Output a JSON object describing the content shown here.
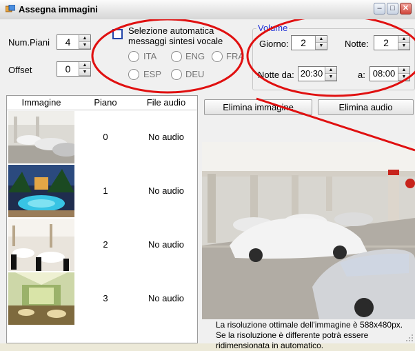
{
  "window": {
    "title": "Assegna immagini",
    "minimize": "–",
    "maximize": "□",
    "close": "✕"
  },
  "settings": {
    "num_piani": {
      "label": "Num.Piani",
      "value": "4"
    },
    "offset": {
      "label": "Offset",
      "value": "0"
    },
    "auto_selection": {
      "label_line1": "Selezione automatica",
      "label_line2": "messaggi sintesi vocale",
      "checked": false,
      "languages": [
        "ITA",
        "ENG",
        "FRA",
        "ESP",
        "DEU"
      ]
    }
  },
  "volume": {
    "legend": "Volume",
    "giorno": {
      "label": "Giorno:",
      "value": "2"
    },
    "notte": {
      "label": "Notte:",
      "value": "2"
    },
    "notte_da": {
      "label": "Notte da:",
      "value": "20:30"
    },
    "a": {
      "label": "a:",
      "value": "08:00"
    }
  },
  "grid": {
    "columns": [
      "Immagine",
      "Piano",
      "File audio"
    ],
    "rows": [
      {
        "thumbnail": "parking-garage-thumbnail",
        "piano": "0",
        "audio": "No audio"
      },
      {
        "thumbnail": "pool-resort-thumbnail",
        "piano": "1",
        "audio": "No audio"
      },
      {
        "thumbnail": "banquet-hall-thumbnail",
        "piano": "2",
        "audio": "No audio"
      },
      {
        "thumbnail": "atrium-hall-thumbnail",
        "piano": "3",
        "audio": "No audio"
      }
    ]
  },
  "actions": {
    "delete_image": "Elimina immagine",
    "delete_audio": "Elimina audio"
  },
  "preview": {
    "image": "parking-garage-preview"
  },
  "note": "La risoluzione ottimale dell'immagine è 588x480px. Se la risoluzione è differente potrà essere ridimensionata in automatico.",
  "colors": {
    "highlight_circle": "#e01010",
    "volume_legend": "#1d2fd6",
    "checkbox_border": "#2345a8"
  }
}
